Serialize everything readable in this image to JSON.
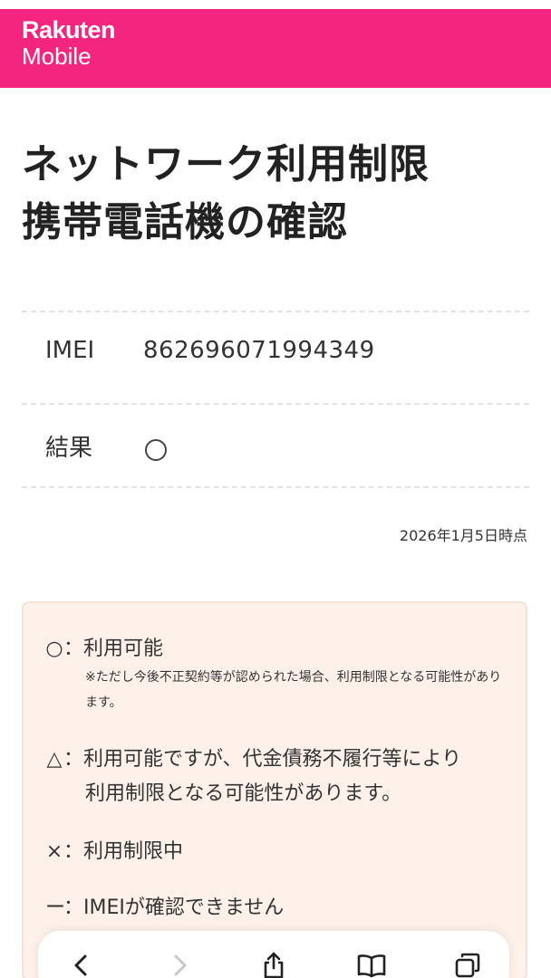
{
  "header": {
    "brand": "Rakuten",
    "product": "Mobile",
    "color": "#f4257f"
  },
  "title": {
    "line1": "ネットワーク利用制限",
    "line2": "携帯電話機の確認"
  },
  "result_table": {
    "imei_label": "IMEI",
    "imei_value": "862696071994349",
    "result_label": "結果",
    "result_symbol": "circle-icon"
  },
  "timestamp": "2026年1月5日時点",
  "legend": {
    "circle": {
      "symbol": "○",
      "text": "：利用可能",
      "note": "※ただし今後不正契約等が認められた場合、利用制限となる可能性があります。"
    },
    "triangle": {
      "symbol": "△",
      "text1": "：利用可能ですが、代金債務不履行等により",
      "text2": "利用制限となる可能性があります。"
    },
    "cross": {
      "symbol": "×",
      "text": "：利用制限中"
    },
    "dash": {
      "symbol": "ー",
      "text": "：IMEIが確認できません"
    },
    "background": "#fdf1ea"
  },
  "toolbar": {
    "icons": [
      "back-icon",
      "forward-icon",
      "share-icon",
      "bookmarks-icon",
      "tabs-icon"
    ]
  }
}
